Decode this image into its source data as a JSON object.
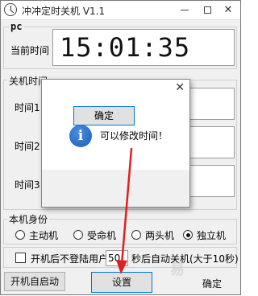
{
  "titlebar": {
    "title": "冲冲定时关机 V1.1",
    "min": "",
    "max": "",
    "close": "✕"
  },
  "pc": {
    "legend": "pc",
    "current_time_label": "当前时间",
    "current_time": "15:01:35"
  },
  "shutdown": {
    "legend": "关机时间",
    "rows": [
      {
        "label": "时间1"
      },
      {
        "label": "时间2"
      },
      {
        "label": "时间3"
      }
    ]
  },
  "identity": {
    "legend": "本机身份",
    "options": [
      {
        "label": "主动机",
        "checked": false
      },
      {
        "label": "受命机",
        "checked": false
      },
      {
        "label": "两头机",
        "checked": false
      },
      {
        "label": "独立机",
        "checked": true
      }
    ]
  },
  "option_row": {
    "checkbox_label": "开机后不登陆用户",
    "seconds_value": "50",
    "suffix": "秒后自动关机(大于10秒)"
  },
  "buttons": {
    "autostart": "开机自启动",
    "settings": "设置",
    "confirm": "确定"
  },
  "dialog": {
    "close": "✕",
    "icon": "i",
    "message": "可以修改时间！",
    "ok": "确定"
  },
  "annotation": {
    "arrow_color": "#e02020"
  },
  "watermark": "易"
}
